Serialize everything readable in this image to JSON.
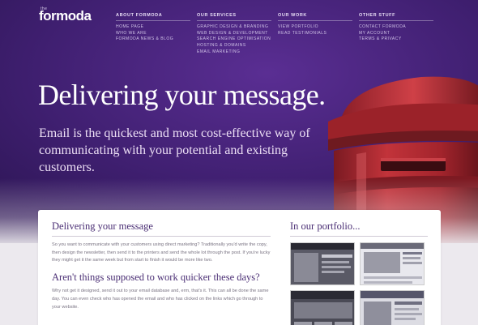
{
  "brand": {
    "logo_small": "the",
    "logo_name": "formoda"
  },
  "nav": {
    "columns": [
      {
        "heading": "ABOUT FORMODA",
        "links": [
          "HOME PAGE",
          "WHO WE ARE",
          "FORMODA NEWS & BLOG"
        ]
      },
      {
        "heading": "OUR SERVICES",
        "links": [
          "GRAPHIC DESIGN & BRANDING",
          "WEB DESIGN & DEVELOPMENT",
          "SEARCH ENGINE OPTIMISATION",
          "HOSTING & DOMAINS",
          "EMAIL MARKETING"
        ]
      },
      {
        "heading": "OUR WORK",
        "links": [
          "VIEW PORTFOLIO",
          "READ TESTIMONIALS"
        ]
      },
      {
        "heading": "OTHER STUFF",
        "links": [
          "CONTACT FORMODA",
          "MY ACCOUNT",
          "TERMS & PRIVACY"
        ]
      }
    ]
  },
  "hero": {
    "headline": "Delivering your message.",
    "intro": "Email is the quickest and most cost-effective way of communicating with your potential and existing customers."
  },
  "content": {
    "section1_title": "Delivering your message",
    "section1_text": "So you want to communicate with your customers using direct marketing? Traditionally you'd write the copy, then design the newsletter, then send it to the printers and send the whole lot through the post. If you're lucky they might get it the same week but from start to finish it would be more like two.",
    "section2_title": "Aren't things supposed to work quicker these days?",
    "section2_text": "Why not get it designed, send it out to your email database and, erm, that's it. This can all be done the same day. You can even check who has opened the email and who has clicked on the links which go through to your website.",
    "portfolio_title": "In our portfolio..."
  },
  "colors": {
    "accent": "#4a2e74",
    "hero": "#3f1f70",
    "postbox": "#b3282f"
  }
}
